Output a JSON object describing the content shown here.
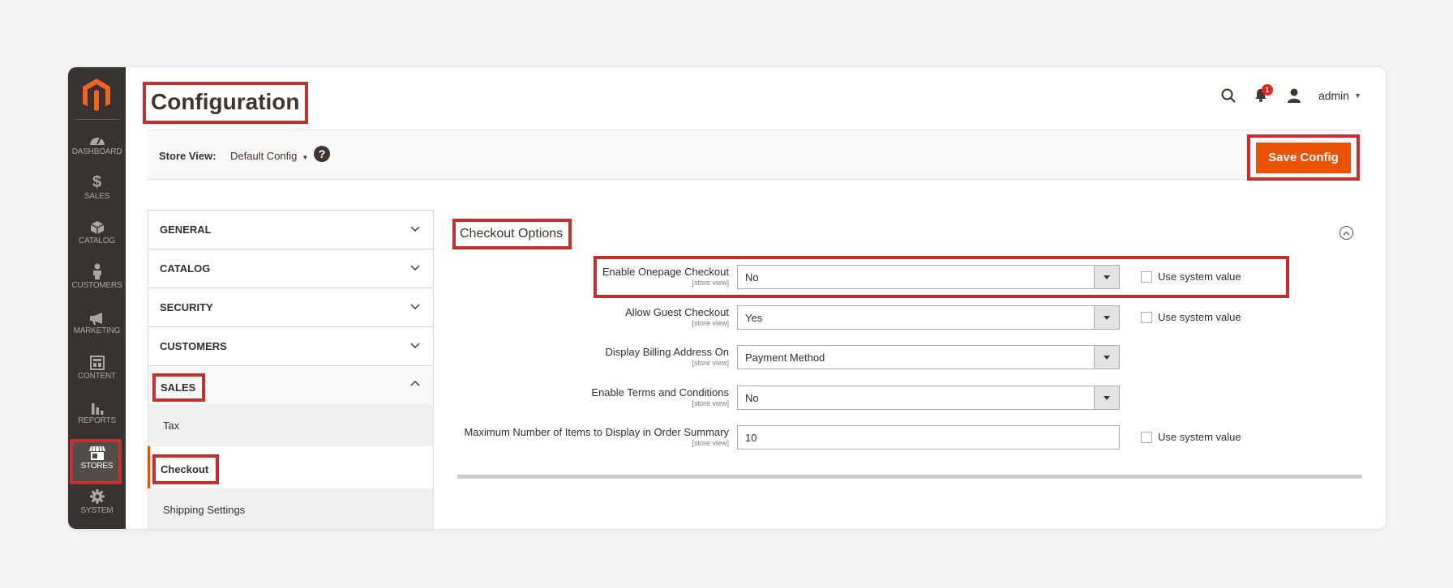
{
  "rail": {
    "items": [
      {
        "label": "DASHBOARD",
        "icon": "dashboard-icon"
      },
      {
        "label": "SALES",
        "icon": "dollar-icon"
      },
      {
        "label": "CATALOG",
        "icon": "cube-icon"
      },
      {
        "label": "CUSTOMERS",
        "icon": "person-icon"
      },
      {
        "label": "MARKETING",
        "icon": "megaphone-icon"
      },
      {
        "label": "CONTENT",
        "icon": "layout-icon"
      },
      {
        "label": "REPORTS",
        "icon": "bar-chart-icon"
      },
      {
        "label": "STORES",
        "icon": "storefront-icon",
        "active": true
      },
      {
        "label": "SYSTEM",
        "icon": "gear-icon"
      }
    ]
  },
  "header": {
    "title": "Configuration",
    "notification_count": "1",
    "username": "admin"
  },
  "store_view": {
    "label": "Store View:",
    "value": "Default Config",
    "help": "?"
  },
  "actions": {
    "save_label": "Save Config"
  },
  "config_nav": {
    "sections": [
      {
        "label": "GENERAL"
      },
      {
        "label": "CATALOG"
      },
      {
        "label": "SECURITY"
      },
      {
        "label": "CUSTOMERS"
      },
      {
        "label": "SALES"
      }
    ],
    "sales_items": [
      {
        "label": "Tax"
      },
      {
        "label": "Checkout"
      },
      {
        "label": "Shipping Settings"
      }
    ]
  },
  "main": {
    "section_title": "Checkout Options",
    "scope_hint": "[store view]",
    "use_system_label": "Use system value",
    "fields": [
      {
        "label": "Enable Onepage Checkout",
        "value": "No"
      },
      {
        "label": "Allow Guest Checkout",
        "value": "Yes"
      },
      {
        "label": "Display Billing Address On",
        "value": "Payment Method"
      },
      {
        "label": "Enable Terms and Conditions",
        "value": "No"
      },
      {
        "label": "Maximum Number of Items to Display in Order Summary",
        "value": "10"
      }
    ]
  },
  "colors": {
    "rail_bg": "#373330",
    "accent": "#eb5202",
    "highlight": "#c3302e",
    "logo": "#f26322"
  }
}
